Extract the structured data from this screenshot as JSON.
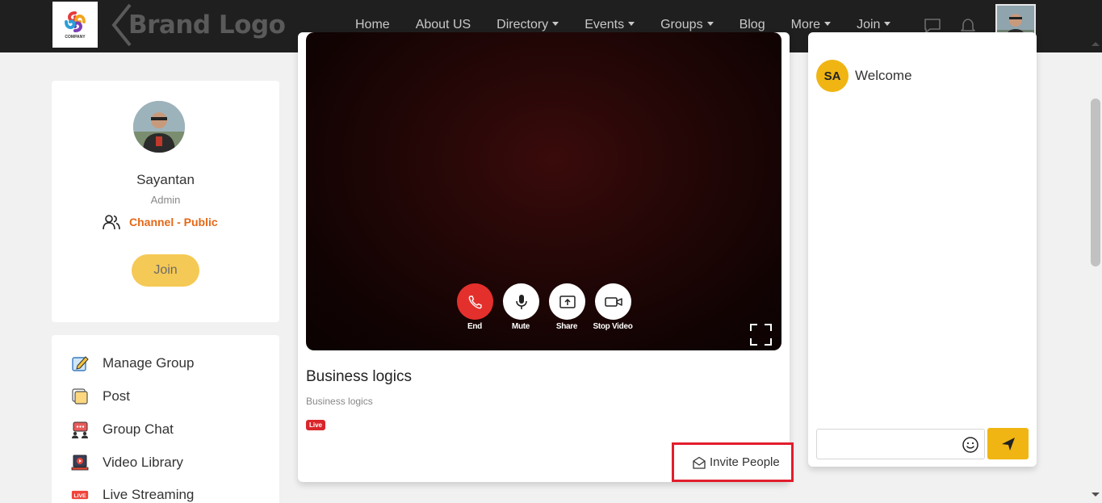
{
  "navbar": {
    "brand_text": "Brand Logo",
    "links": [
      {
        "label": "Home",
        "dropdown": false
      },
      {
        "label": "About US",
        "dropdown": false
      },
      {
        "label": "Directory",
        "dropdown": true
      },
      {
        "label": "Events",
        "dropdown": true
      },
      {
        "label": "Groups",
        "dropdown": true
      },
      {
        "label": "Blog",
        "dropdown": false
      },
      {
        "label": "More",
        "dropdown": true
      },
      {
        "label": "Join",
        "dropdown": true
      }
    ],
    "icons": [
      "chat-bubble-icon",
      "bell-icon"
    ]
  },
  "profile": {
    "name": "Sayantan",
    "role": "Admin",
    "channel_label": "Channel - Public",
    "join_label": "Join"
  },
  "menu": {
    "items": [
      {
        "label": "Manage Group",
        "icon": "edit-icon"
      },
      {
        "label": "Post",
        "icon": "post-icon"
      },
      {
        "label": "Group Chat",
        "icon": "group-chat-icon"
      },
      {
        "label": "Video Library",
        "icon": "video-library-icon"
      },
      {
        "label": "Live Streaming",
        "icon": "live-icon"
      }
    ],
    "live_icon_text": "LIVE"
  },
  "video": {
    "controls": [
      {
        "label": "End",
        "icon": "phone-end-icon"
      },
      {
        "label": "Mute",
        "icon": "microphone-icon"
      },
      {
        "label": "Share",
        "icon": "share-screen-icon"
      },
      {
        "label": "Stop Video",
        "icon": "video-camera-icon"
      }
    ]
  },
  "stream": {
    "title": "Business logics",
    "subtitle": "Business logics",
    "badge": "Live",
    "invite_label": "Invite People"
  },
  "chat": {
    "avatar_initials": "SA",
    "message": "Welcome",
    "input_value": "",
    "input_placeholder": ""
  },
  "colors": {
    "navbar_bg": "#1f1f1f",
    "accent_yellow": "#f0b512",
    "join_yellow": "#f5c955",
    "channel_orange": "#e46817",
    "end_red": "#e4302c",
    "highlight_red": "#e21d2c"
  }
}
